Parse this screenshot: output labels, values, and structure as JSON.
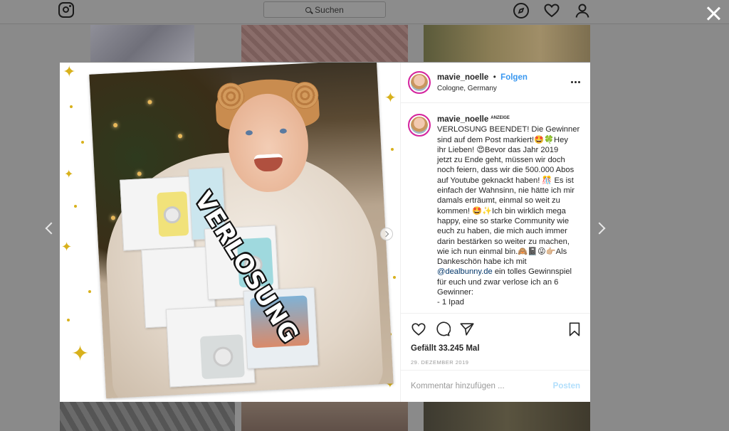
{
  "header": {
    "search_placeholder": "Suchen",
    "icons": [
      "instagram-logo",
      "compass-icon",
      "heart-icon",
      "user-icon"
    ]
  },
  "post": {
    "username": "mavie_noelle",
    "separator": "•",
    "follow_label": "Folgen",
    "location": "Cologne, Germany",
    "more_icon": "ellipsis-icon",
    "photo_text": "VERLOSUNG",
    "caption_username": "mavie_noelle",
    "caption_badge": "ANZEIGE",
    "caption_lines": [
      "VERLOSUNG BEENDET! Die Gewinner",
      "sind auf dem Post markiert!🤩🍀Hey",
      "ihr Lieben! 😍Bevor das Jahr 2019",
      "jetzt zu Ende geht, müssen wir doch",
      "noch feiern, dass wir die 500.000 Abos",
      "auf Youtube geknackt haben! 🎊 Es ist",
      "einfach der Wahnsinn, nie hätte ich mir",
      "damals erträumt, einmal so weit zu",
      "kommen! 🤩✨Ich bin wirklich mega",
      "happy, eine so starke Community wie",
      "euch zu haben, die mich auch immer",
      "darin bestärken so weiter zu machen,",
      "wie ich nun einmal bin.🙈📓😜👉🏼Als",
      "Dankeschön habe ich mit"
    ],
    "caption_mention": "@dealbunny.de",
    "caption_after_mention": " ein tolles Gewinnspiel",
    "caption_tail": [
      "für euch und zwar verlose ich an 6",
      "Gewinner:",
      "- 1 Ipad"
    ],
    "likes": "Gefällt 33.245 Mal",
    "date": "29. DEZEMBER 2019",
    "comment_placeholder": "Kommentar hinzufügen ...",
    "post_button": "Posten"
  },
  "colors": {
    "follow_blue": "#3897f0",
    "mention_blue": "#003569",
    "post_disabled": "#b2dffc",
    "gold": "#d8b11c"
  }
}
